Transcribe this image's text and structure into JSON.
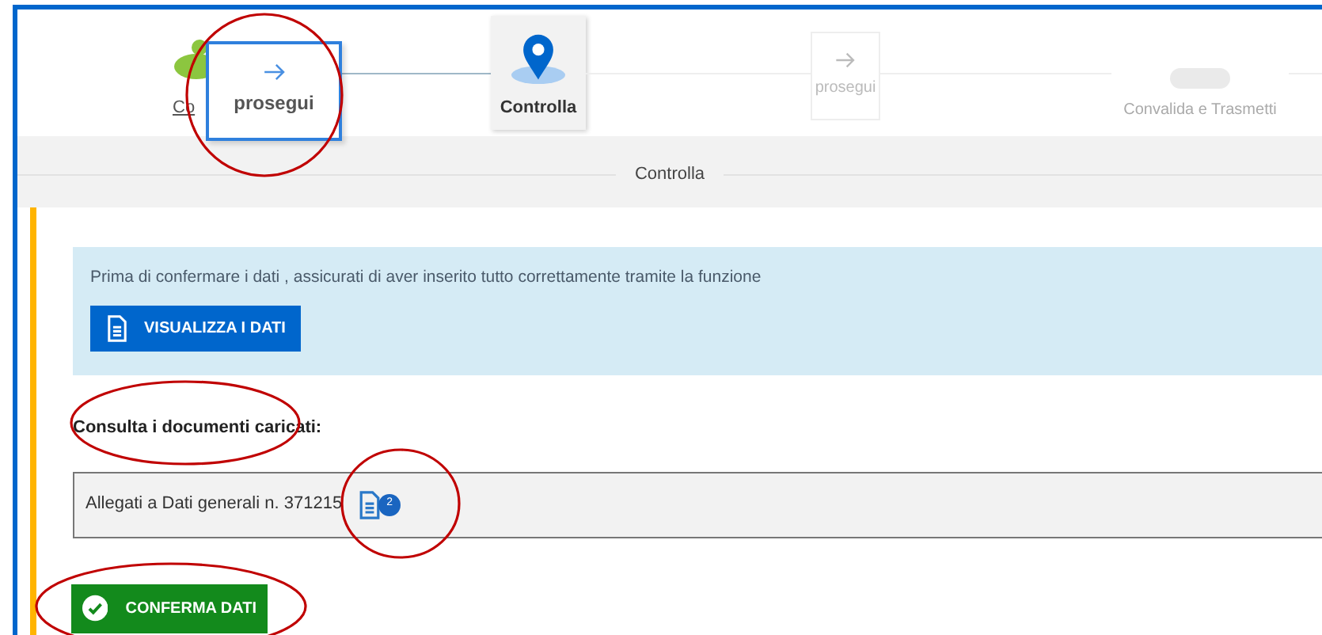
{
  "stepper": {
    "steps": [
      {
        "kind": "done",
        "label": "Co"
      },
      {
        "kind": "current",
        "label": "Controlla"
      },
      {
        "kind": "ghost",
        "label": "prosegui"
      },
      {
        "kind": "pending",
        "label": "Convalida e Trasmetti"
      }
    ],
    "overlay_button": {
      "label": "prosegui"
    }
  },
  "section_title": "Controlla",
  "info": {
    "text": "Prima di confermare i dati , assicurati di aver inserito tutto correttamente tramite la funzione",
    "button": "VISUALIZZA I DATI"
  },
  "documents": {
    "heading": "Consulta i documenti caricati:",
    "item": {
      "label": "Allegati a Dati generali n. 371215",
      "count": "2"
    }
  },
  "confirm_button": "CONFERMA DATI"
}
